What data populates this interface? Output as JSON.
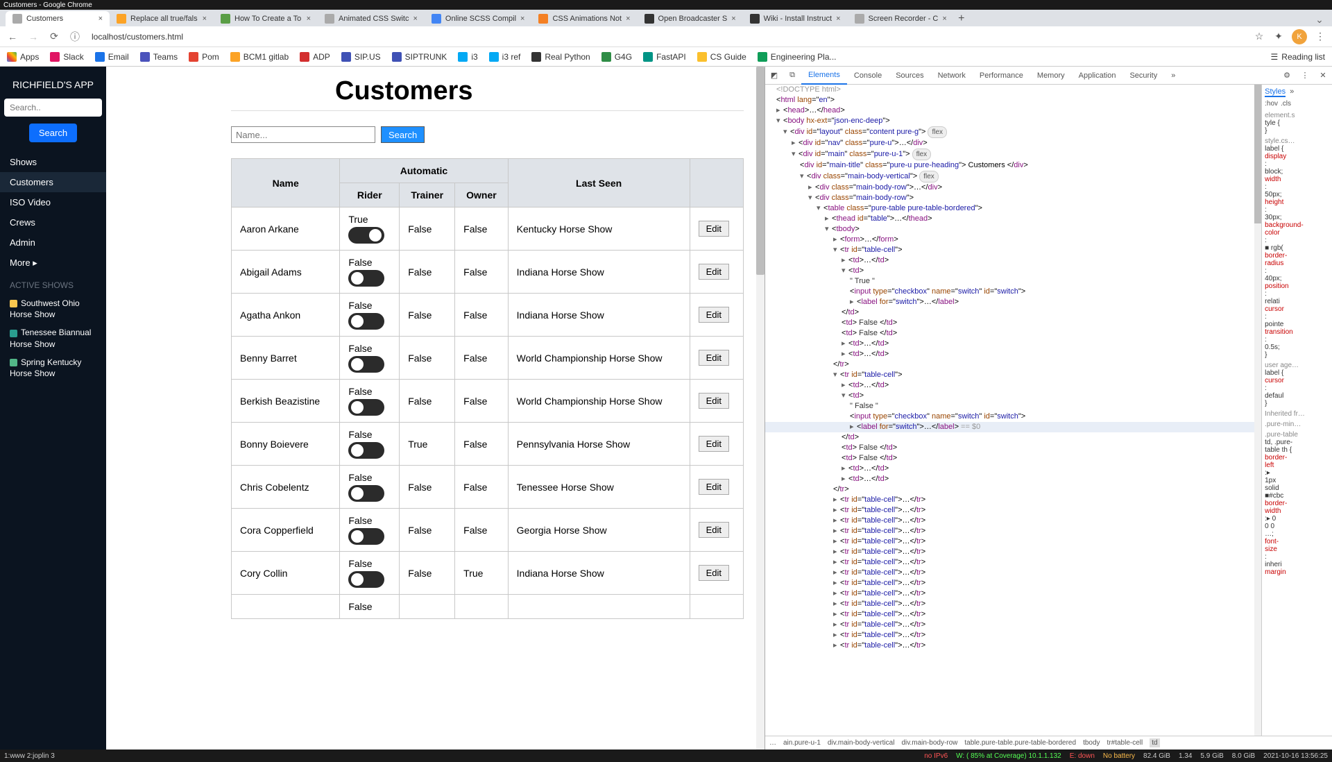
{
  "window_title": "Customers - Google Chrome",
  "tabs": [
    {
      "label": "Customers",
      "color": "#aaa",
      "active": true
    },
    {
      "label": "Replace all true/fals",
      "color": "#fca326"
    },
    {
      "label": "How To Create a To",
      "color": "#5a9e46"
    },
    {
      "label": "Animated CSS Switc",
      "color": "#aaa"
    },
    {
      "label": "Online SCSS Compil",
      "color": "#4285f4"
    },
    {
      "label": "CSS Animations Not",
      "color": "#f48024"
    },
    {
      "label": "Open Broadcaster S",
      "color": "#333"
    },
    {
      "label": "Wiki - Install Instruct",
      "color": "#333"
    },
    {
      "label": "Screen Recorder - C",
      "color": "#aaa"
    }
  ],
  "url": "localhost/customers.html",
  "avatar_letter": "K",
  "bookmarks": [
    {
      "label": "Apps",
      "color": "#666"
    },
    {
      "label": "Slack",
      "color": "#e01563"
    },
    {
      "label": "Email",
      "color": "#1a73e8"
    },
    {
      "label": "Teams",
      "color": "#4b53bc"
    },
    {
      "label": "Pom",
      "color": "#e44332"
    },
    {
      "label": "BCM1 gitlab",
      "color": "#fca326"
    },
    {
      "label": "ADP",
      "color": "#d32f2f"
    },
    {
      "label": "SIP.US",
      "color": "#3f51b5"
    },
    {
      "label": "SIPTRUNK",
      "color": "#3f51b5"
    },
    {
      "label": "i3",
      "color": "#03a9f4"
    },
    {
      "label": "i3 ref",
      "color": "#03a9f4"
    },
    {
      "label": "Real Python",
      "color": "#333"
    },
    {
      "label": "G4G",
      "color": "#2f8d46"
    },
    {
      "label": "FastAPI",
      "color": "#009485"
    },
    {
      "label": "CS Guide",
      "color": "#fbc02d"
    },
    {
      "label": "Engineering Pla...",
      "color": "#0f9d58"
    }
  ],
  "reading_list": "Reading list",
  "sidebar": {
    "app": "RICHFIELD'S APP",
    "search_ph": "Search..",
    "btn": "Search",
    "links": [
      "Shows",
      "Customers",
      "ISO Video",
      "Crews",
      "Admin",
      "More ▸"
    ],
    "active_head": "ACTIVE SHOWS",
    "shows": [
      {
        "dot": "#f9c74f",
        "label": "Southwest Ohio Horse Show"
      },
      {
        "dot": "#2a9d8f",
        "label": "Tenessee Biannual Horse Show"
      },
      {
        "dot": "#52b788",
        "label": "Spring Kentucky Horse Show"
      }
    ]
  },
  "page": {
    "title": "Customers",
    "name_ph": "Name...",
    "search": "Search",
    "headers": {
      "name": "Name",
      "auto": "Automatic",
      "rider": "Rider",
      "trainer": "Trainer",
      "owner": "Owner",
      "last": "Last Seen",
      "edit": "Edit"
    },
    "rows": [
      {
        "name": "Aaron Arkane",
        "rider": "True",
        "r_on": true,
        "trainer": "False",
        "owner": "False",
        "last": "Kentucky Horse Show"
      },
      {
        "name": "Abigail Adams",
        "rider": "False",
        "r_on": false,
        "trainer": "False",
        "owner": "False",
        "last": "Indiana Horse Show"
      },
      {
        "name": "Agatha Ankon",
        "rider": "False",
        "r_on": false,
        "trainer": "False",
        "owner": "False",
        "last": "Indiana Horse Show"
      },
      {
        "name": "Benny Barret",
        "rider": "False",
        "r_on": false,
        "trainer": "False",
        "owner": "False",
        "last": "World Championship Horse Show"
      },
      {
        "name": "Berkish Beazistine",
        "rider": "False",
        "r_on": false,
        "trainer": "False",
        "owner": "False",
        "last": "World Championship Horse Show"
      },
      {
        "name": "Bonny Boievere",
        "rider": "False",
        "r_on": false,
        "trainer": "True",
        "owner": "False",
        "last": "Pennsylvania Horse Show"
      },
      {
        "name": "Chris Cobelentz",
        "rider": "False",
        "r_on": false,
        "trainer": "False",
        "owner": "False",
        "last": "Tenessee Horse Show"
      },
      {
        "name": "Cora Copperfield",
        "rider": "False",
        "r_on": false,
        "trainer": "False",
        "owner": "False",
        "last": "Georgia Horse Show"
      },
      {
        "name": "Cory Collin",
        "rider": "False",
        "r_on": false,
        "trainer": "False",
        "owner": "True",
        "last": "Indiana Horse Show"
      }
    ],
    "partial": "False"
  },
  "devtools": {
    "tabs": [
      "Elements",
      "Console",
      "Sources",
      "Network",
      "Performance",
      "Memory",
      "Application",
      "Security"
    ],
    "more": "»",
    "sel_note": "== $0",
    "flex": "flex",
    "crumbs": [
      "…",
      "ain.pure-u-1",
      "div.main-body-vertical",
      "div.main-body-row",
      "table.pure-table.pure-table-bordered",
      "tbody",
      "tr#table-cell",
      "td"
    ],
    "styles": {
      "tabs": [
        "Styles",
        "»"
      ],
      "hov": ":hov",
      "cls": ".cls",
      "lines": [
        "element.s",
        "tyle {",
        "}",
        "style.cs…",
        "label {",
        "display",
        ":",
        "block;",
        "width",
        ":",
        "50px;",
        "height",
        ":",
        "30px;",
        "background-",
        "color",
        ":",
        "■ rgb(",
        "border-",
        "radius",
        ":",
        "40px;",
        "position",
        ":",
        "relati",
        "cursor",
        ":",
        "pointe",
        "transition",
        ":",
        "0.5s;",
        "}",
        "user age…",
        "label {",
        "cursor",
        ":",
        "defaul",
        "}",
        "Inherited fr…",
        ".pure-min…",
        ".pure-table",
        "td, .pure-",
        "table th {",
        "border-",
        "left",
        ":▸",
        "1px",
        "solid",
        "■#cbc",
        "border-",
        "width",
        ":▸ 0",
        "0 0",
        "…;",
        "font-",
        "size",
        ":",
        "inheri",
        "margin"
      ]
    }
  },
  "statusbar": {
    "left": "1:www  2:joplin  3",
    "items": [
      "no IPv6",
      "W: ( 85% at Coverage) 10.1.1.132",
      "E: down",
      "No battery",
      "82.4 GiB",
      "1.34",
      "5.9 GiB",
      "8.0 GiB",
      "2021-10-16 13:56:25"
    ]
  }
}
